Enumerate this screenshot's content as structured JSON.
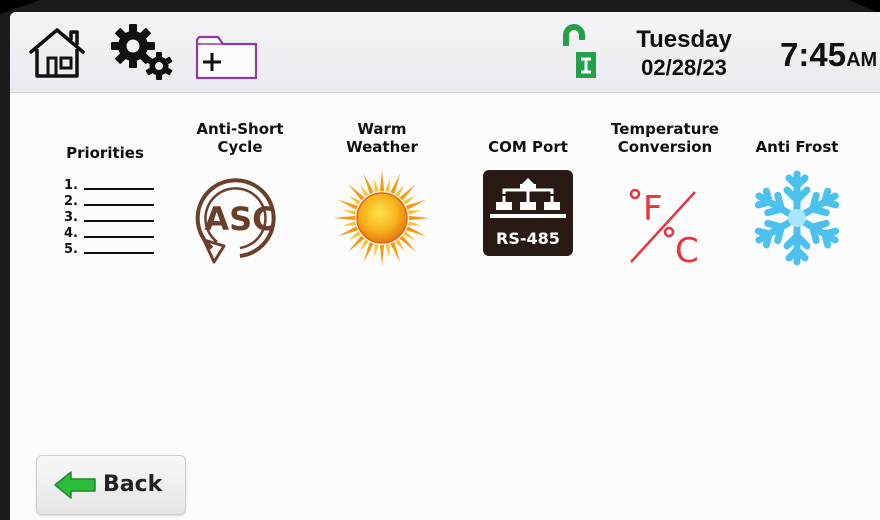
{
  "header": {
    "day": "Tuesday",
    "date": "02/28/23",
    "time": "7:45",
    "ampm": "AM",
    "lock_status": "unlocked"
  },
  "tiles": [
    {
      "label": "Priorities",
      "icon": "priorities-list-icon"
    },
    {
      "label": "Anti-Short\nCycle",
      "icon": "asc-icon",
      "icon_text": "ASC"
    },
    {
      "label": "Warm\nWeather",
      "icon": "sun-icon"
    },
    {
      "label": "COM Port",
      "icon": "rs485-port-icon",
      "icon_text": "RS-485"
    },
    {
      "label": "Temperature\nConversion",
      "icon": "f-to-c-icon"
    },
    {
      "label": "Anti Frost",
      "icon": "snowflake-icon"
    }
  ],
  "priorities": [
    "1.",
    "2.",
    "3.",
    "4.",
    "5."
  ],
  "back_label": "Back",
  "colors": {
    "lock_green": "#22a04a",
    "asc_brown": "#6b3f2a",
    "sun_orange": "#f39a12",
    "temp_red": "#e8323c",
    "frost_blue": "#4cc1ee",
    "back_arrow_green": "#2dbb3c",
    "folder_purple": "#8d3c9e"
  }
}
